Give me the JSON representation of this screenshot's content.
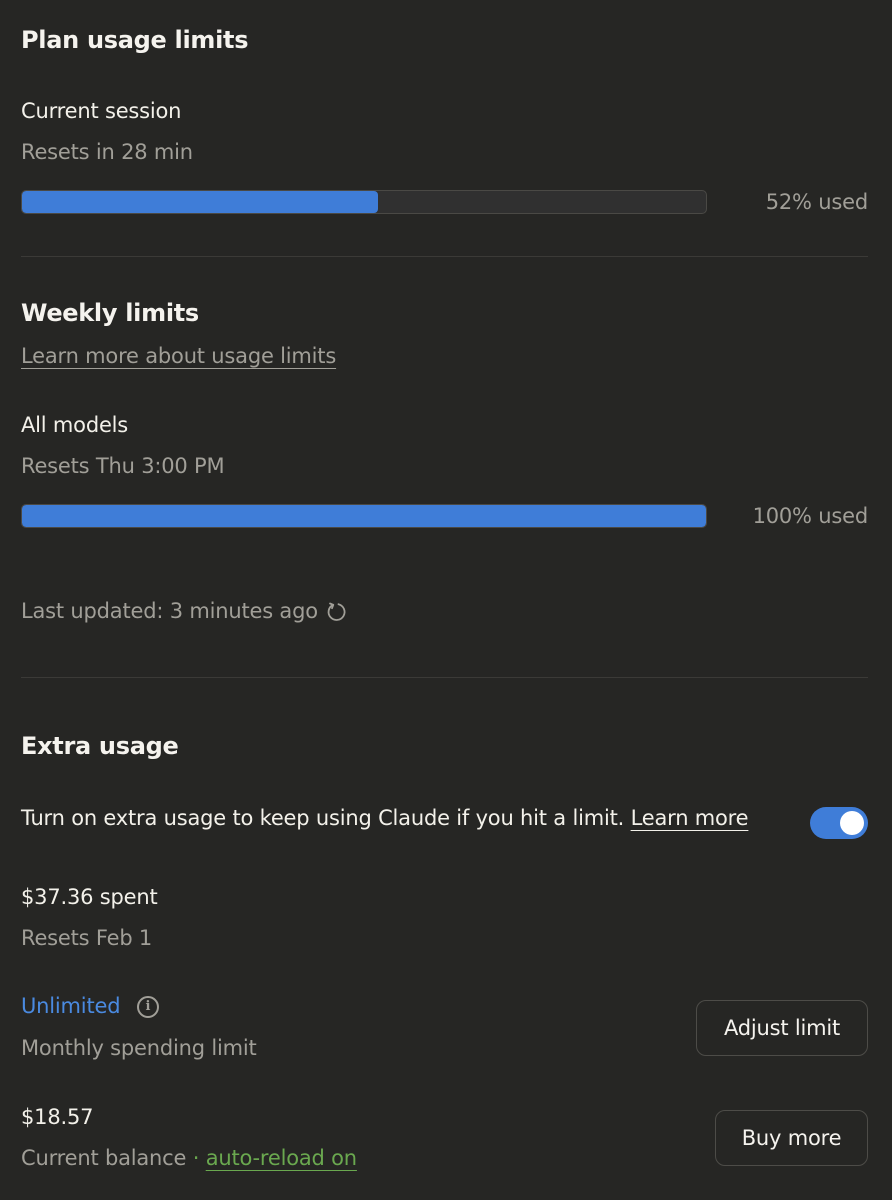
{
  "plan": {
    "title": "Plan usage limits",
    "session": {
      "label": "Current session",
      "reset": "Resets in 28 min",
      "used_text": "52% used",
      "used_fraction": 0.52
    }
  },
  "weekly": {
    "title": "Weekly limits",
    "learn_link": "Learn more about usage limits",
    "all_models": {
      "label": "All models",
      "reset": "Resets Thu 3:00 PM",
      "used_text": "100% used",
      "used_fraction": 1.0
    },
    "last_updated": "Last updated: 3 minutes ago",
    "refresh_icon": "refresh-icon"
  },
  "extra": {
    "title": "Extra usage",
    "description": "Turn on extra usage to keep using Claude if you hit a limit.",
    "learn_more": "Learn more",
    "toggle_on": true,
    "spent": "$37.36 spent",
    "spent_reset": "Resets Feb 1",
    "limit_value": "Unlimited",
    "limit_label": "Monthly spending limit",
    "adjust_button": "Adjust limit",
    "balance": "$18.57",
    "balance_label": "Current balance",
    "separator": "·",
    "auto_reload": "auto-reload on",
    "buy_button": "Buy more",
    "info_icon": "info-icon"
  },
  "colors": {
    "background": "#262624",
    "progress": "#3f7dd8",
    "accent_blue": "#4a8ae0",
    "link_green": "#6aa84f"
  }
}
